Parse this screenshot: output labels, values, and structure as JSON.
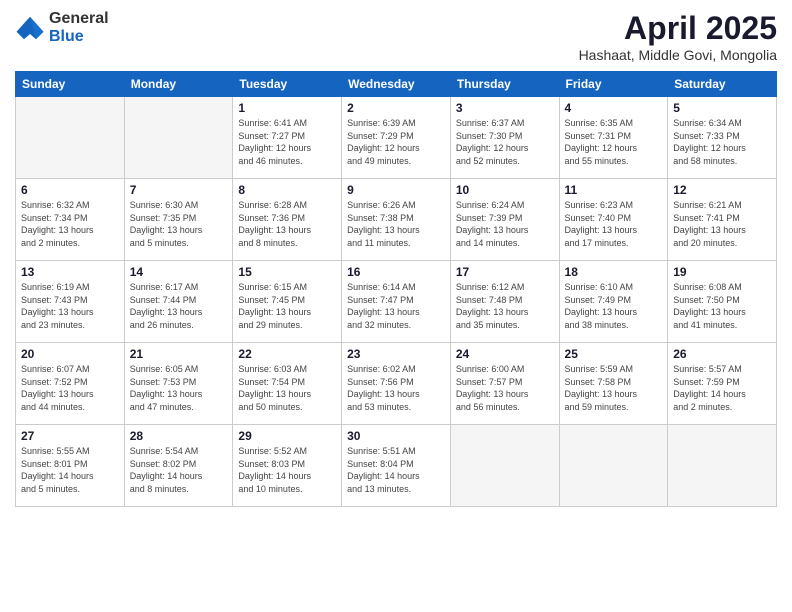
{
  "header": {
    "logo_general": "General",
    "logo_blue": "Blue",
    "month_title": "April 2025",
    "subtitle": "Hashaat, Middle Govi, Mongolia"
  },
  "days_of_week": [
    "Sunday",
    "Monday",
    "Tuesday",
    "Wednesday",
    "Thursday",
    "Friday",
    "Saturday"
  ],
  "weeks": [
    [
      {
        "day": "",
        "info": ""
      },
      {
        "day": "",
        "info": ""
      },
      {
        "day": "1",
        "info": "Sunrise: 6:41 AM\nSunset: 7:27 PM\nDaylight: 12 hours\nand 46 minutes."
      },
      {
        "day": "2",
        "info": "Sunrise: 6:39 AM\nSunset: 7:29 PM\nDaylight: 12 hours\nand 49 minutes."
      },
      {
        "day": "3",
        "info": "Sunrise: 6:37 AM\nSunset: 7:30 PM\nDaylight: 12 hours\nand 52 minutes."
      },
      {
        "day": "4",
        "info": "Sunrise: 6:35 AM\nSunset: 7:31 PM\nDaylight: 12 hours\nand 55 minutes."
      },
      {
        "day": "5",
        "info": "Sunrise: 6:34 AM\nSunset: 7:33 PM\nDaylight: 12 hours\nand 58 minutes."
      }
    ],
    [
      {
        "day": "6",
        "info": "Sunrise: 6:32 AM\nSunset: 7:34 PM\nDaylight: 13 hours\nand 2 minutes."
      },
      {
        "day": "7",
        "info": "Sunrise: 6:30 AM\nSunset: 7:35 PM\nDaylight: 13 hours\nand 5 minutes."
      },
      {
        "day": "8",
        "info": "Sunrise: 6:28 AM\nSunset: 7:36 PM\nDaylight: 13 hours\nand 8 minutes."
      },
      {
        "day": "9",
        "info": "Sunrise: 6:26 AM\nSunset: 7:38 PM\nDaylight: 13 hours\nand 11 minutes."
      },
      {
        "day": "10",
        "info": "Sunrise: 6:24 AM\nSunset: 7:39 PM\nDaylight: 13 hours\nand 14 minutes."
      },
      {
        "day": "11",
        "info": "Sunrise: 6:23 AM\nSunset: 7:40 PM\nDaylight: 13 hours\nand 17 minutes."
      },
      {
        "day": "12",
        "info": "Sunrise: 6:21 AM\nSunset: 7:41 PM\nDaylight: 13 hours\nand 20 minutes."
      }
    ],
    [
      {
        "day": "13",
        "info": "Sunrise: 6:19 AM\nSunset: 7:43 PM\nDaylight: 13 hours\nand 23 minutes."
      },
      {
        "day": "14",
        "info": "Sunrise: 6:17 AM\nSunset: 7:44 PM\nDaylight: 13 hours\nand 26 minutes."
      },
      {
        "day": "15",
        "info": "Sunrise: 6:15 AM\nSunset: 7:45 PM\nDaylight: 13 hours\nand 29 minutes."
      },
      {
        "day": "16",
        "info": "Sunrise: 6:14 AM\nSunset: 7:47 PM\nDaylight: 13 hours\nand 32 minutes."
      },
      {
        "day": "17",
        "info": "Sunrise: 6:12 AM\nSunset: 7:48 PM\nDaylight: 13 hours\nand 35 minutes."
      },
      {
        "day": "18",
        "info": "Sunrise: 6:10 AM\nSunset: 7:49 PM\nDaylight: 13 hours\nand 38 minutes."
      },
      {
        "day": "19",
        "info": "Sunrise: 6:08 AM\nSunset: 7:50 PM\nDaylight: 13 hours\nand 41 minutes."
      }
    ],
    [
      {
        "day": "20",
        "info": "Sunrise: 6:07 AM\nSunset: 7:52 PM\nDaylight: 13 hours\nand 44 minutes."
      },
      {
        "day": "21",
        "info": "Sunrise: 6:05 AM\nSunset: 7:53 PM\nDaylight: 13 hours\nand 47 minutes."
      },
      {
        "day": "22",
        "info": "Sunrise: 6:03 AM\nSunset: 7:54 PM\nDaylight: 13 hours\nand 50 minutes."
      },
      {
        "day": "23",
        "info": "Sunrise: 6:02 AM\nSunset: 7:56 PM\nDaylight: 13 hours\nand 53 minutes."
      },
      {
        "day": "24",
        "info": "Sunrise: 6:00 AM\nSunset: 7:57 PM\nDaylight: 13 hours\nand 56 minutes."
      },
      {
        "day": "25",
        "info": "Sunrise: 5:59 AM\nSunset: 7:58 PM\nDaylight: 13 hours\nand 59 minutes."
      },
      {
        "day": "26",
        "info": "Sunrise: 5:57 AM\nSunset: 7:59 PM\nDaylight: 14 hours\nand 2 minutes."
      }
    ],
    [
      {
        "day": "27",
        "info": "Sunrise: 5:55 AM\nSunset: 8:01 PM\nDaylight: 14 hours\nand 5 minutes."
      },
      {
        "day": "28",
        "info": "Sunrise: 5:54 AM\nSunset: 8:02 PM\nDaylight: 14 hours\nand 8 minutes."
      },
      {
        "day": "29",
        "info": "Sunrise: 5:52 AM\nSunset: 8:03 PM\nDaylight: 14 hours\nand 10 minutes."
      },
      {
        "day": "30",
        "info": "Sunrise: 5:51 AM\nSunset: 8:04 PM\nDaylight: 14 hours\nand 13 minutes."
      },
      {
        "day": "",
        "info": ""
      },
      {
        "day": "",
        "info": ""
      },
      {
        "day": "",
        "info": ""
      }
    ]
  ]
}
